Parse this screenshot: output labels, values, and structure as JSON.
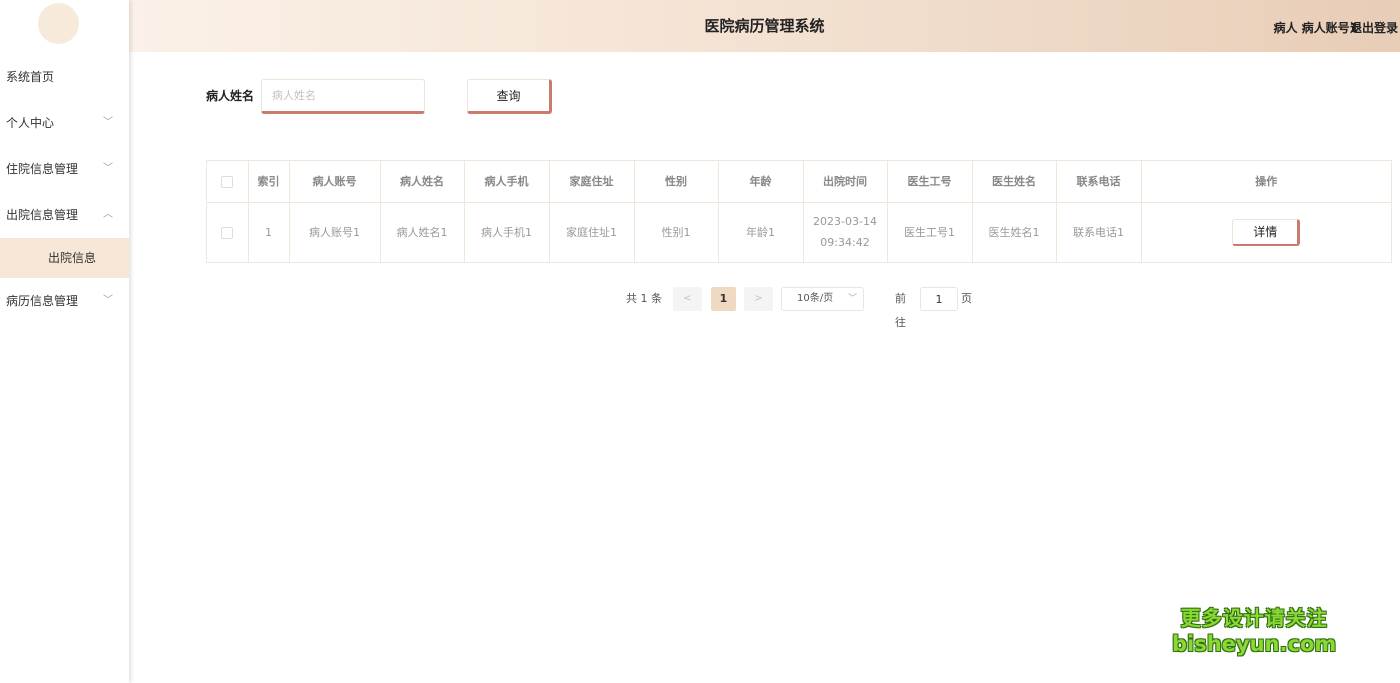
{
  "header": {
    "title": "医院病历管理系统",
    "user": "病人 病人账号1",
    "logout": "退出登录"
  },
  "sidebar": {
    "items": [
      {
        "label": "系统首页",
        "chevron": ""
      },
      {
        "label": "个人中心",
        "chevron": "﹀"
      },
      {
        "label": "住院信息管理",
        "chevron": "﹀"
      },
      {
        "label": "出院信息管理",
        "chevron": "︿"
      },
      {
        "label": "病历信息管理",
        "chevron": "﹀"
      }
    ],
    "active_sub": "出院信息"
  },
  "search": {
    "label": "病人姓名",
    "placeholder": "病人姓名",
    "button": "查询"
  },
  "table": {
    "headers": [
      "索引",
      "病人账号",
      "病人姓名",
      "病人手机",
      "家庭住址",
      "性别",
      "年龄",
      "出院时间",
      "医生工号",
      "医生姓名",
      "联系电话",
      "操作"
    ],
    "rows": [
      {
        "index": "1",
        "account": "病人账号1",
        "name": "病人姓名1",
        "phone": "病人手机1",
        "address": "家庭住址1",
        "gender": "性别1",
        "age": "年龄1",
        "discharge_date": "2023-03-14",
        "discharge_time": "09:34:42",
        "doctor_id": "医生工号1",
        "doctor_name": "医生姓名1",
        "contact": "联系电话1",
        "action": "详情"
      }
    ]
  },
  "pagination": {
    "total": "共 1 条",
    "prev": "<",
    "current": "1",
    "next": ">",
    "page_size": "10条/页",
    "goto_prefix": "前往",
    "goto_value": "1",
    "goto_suffix": "页"
  },
  "watermark": {
    "line1": "更多设计请关注",
    "line2": "bisheyun.com"
  },
  "colors": {
    "accent": "#c97b6e",
    "active_bg": "#f7e7d7",
    "header_start": "#fbf1e8",
    "header_end": "#e8cdb7"
  }
}
